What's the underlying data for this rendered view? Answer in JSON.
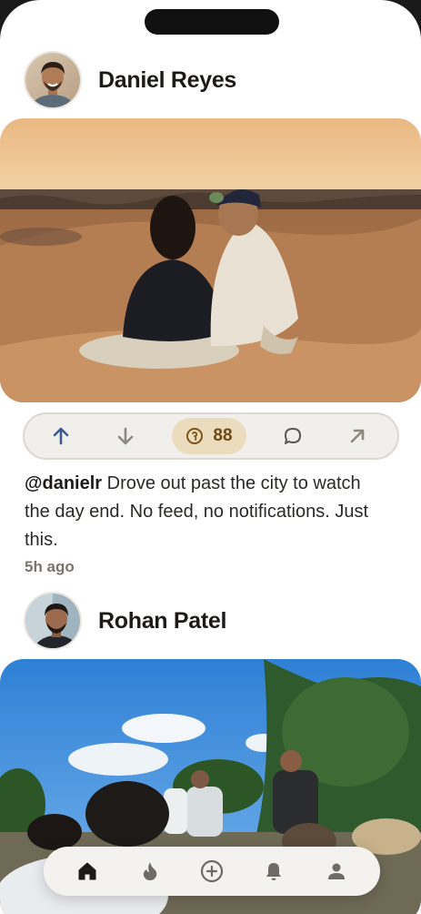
{
  "posts": [
    {
      "author": "Daniel Reyes",
      "handle": "@danielr",
      "caption": " Drove out past the city to watch the day end. No feed, no notifications. Just this.",
      "time": "5h ago",
      "score": "88"
    },
    {
      "author": "Rohan Patel"
    }
  ],
  "colors": {
    "accent_upvote": "#3e5a94",
    "score_pill": "#ecdcbe",
    "score_text": "#6b4a17"
  },
  "icons": {
    "upvote": "arrow-up-icon",
    "downvote": "arrow-down-icon",
    "score": "score-badge-icon",
    "comment": "comment-icon",
    "share": "share-arrow-icon",
    "tabs": [
      "home-icon",
      "flame-icon",
      "plus-circle-icon",
      "bell-icon",
      "person-icon"
    ]
  }
}
